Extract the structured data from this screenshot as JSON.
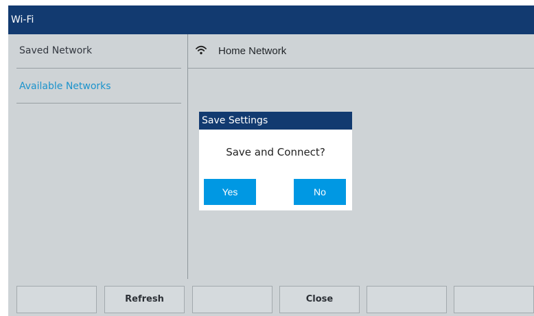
{
  "window": {
    "title": "Wi-Fi"
  },
  "sidebar": {
    "items": [
      {
        "label": "Saved Network",
        "active": false
      },
      {
        "label": "Available Networks",
        "active": true
      }
    ]
  },
  "networks": [
    {
      "name": "Home Network",
      "icon": "wifi-icon"
    }
  ],
  "dialog": {
    "title": "Save Settings",
    "message": "Save and Connect?",
    "yes_label": "Yes",
    "no_label": "No"
  },
  "toolbar": {
    "buttons": [
      "",
      "Refresh",
      "",
      "Close",
      "",
      ""
    ]
  },
  "colors": {
    "header": "#123a70",
    "background": "#ced3d6",
    "accent": "#0098e3",
    "active_text": "#1b93cc"
  }
}
